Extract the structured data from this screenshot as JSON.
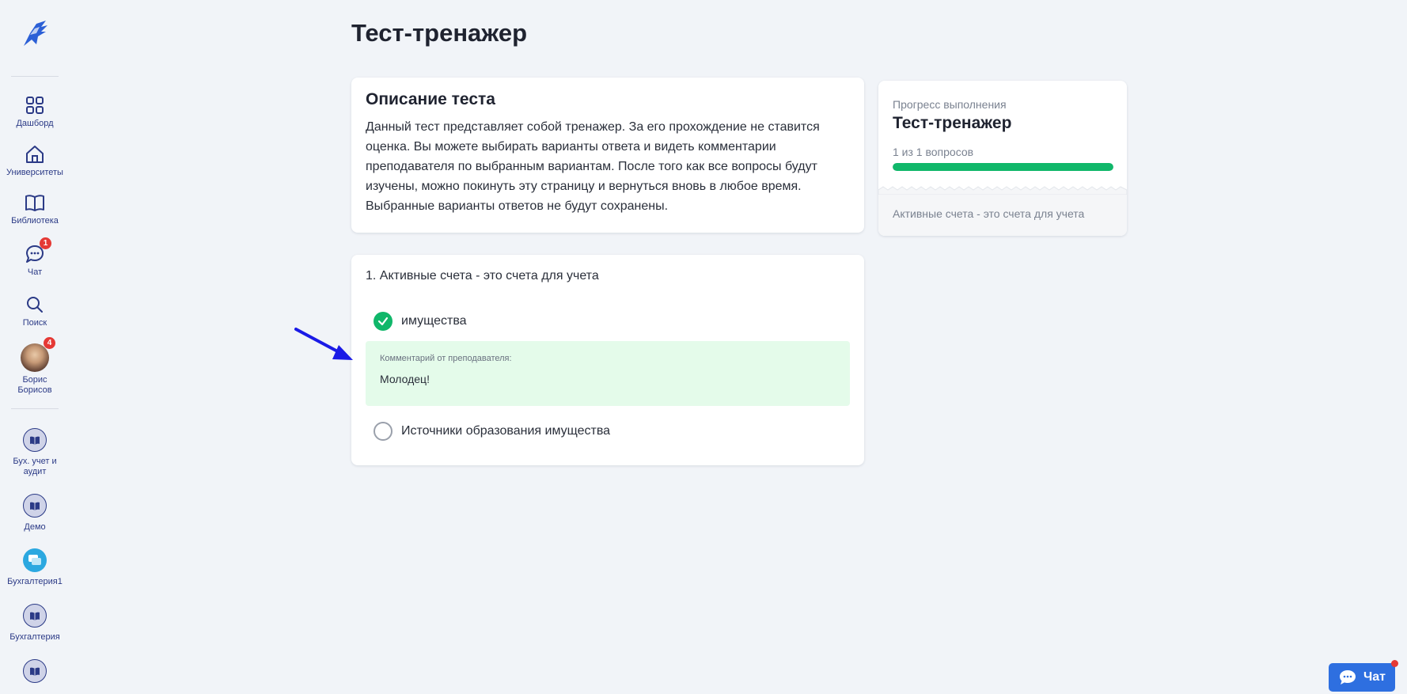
{
  "page": {
    "title": "Тест-тренажер"
  },
  "sidebar": {
    "nav": [
      {
        "label": "Дашборд",
        "icon": "dashboard-grid-icon"
      },
      {
        "label": "Университеты",
        "icon": "university-home-icon"
      },
      {
        "label": "Библиотека",
        "icon": "book-icon"
      },
      {
        "label": "Чат",
        "icon": "chat-icon",
        "badge": "1"
      },
      {
        "label": "Поиск",
        "icon": "search-icon"
      },
      {
        "label": "Борис Борисов",
        "icon": "avatar",
        "badge": "4"
      }
    ],
    "courses": [
      {
        "label": "Бух. учет и аудит",
        "icon": "course-book-icon"
      },
      {
        "label": "Демо",
        "icon": "course-book-icon"
      },
      {
        "label": "Бухгалтерия1",
        "icon": "course-chat-icon"
      },
      {
        "label": "Бухгалтерия",
        "icon": "course-book-icon"
      },
      {
        "label": "",
        "icon": "course-book-icon"
      }
    ]
  },
  "description": {
    "title": "Описание теста",
    "text": "Данный тест представляет собой тренажер. За его прохождение не ставится оценка. Вы можете выбирать варианты ответа и видеть комментарии преподавателя по выбранным вариантам. После того как все вопросы будут изучены, можно покинуть эту страницу и вернуться вновь в любое время. Выбранные варианты ответов не будут сохранены."
  },
  "question": {
    "title": "1. Активные счета - это счета для учета",
    "options": [
      {
        "label": "имущества",
        "selected": true
      },
      {
        "label": "Источники образования имущества",
        "selected": false
      }
    ],
    "comment": {
      "label": "Комментарий от преподавателя:",
      "text": "Молодец!"
    }
  },
  "progress": {
    "label": "Прогресс выполнения",
    "title": "Тест-тренажер",
    "count": "1 из 1 вопросов",
    "fraction": 1.0,
    "items": [
      "Активные счета - это счета для учета"
    ]
  },
  "chat_button": {
    "label": "Чат"
  },
  "colors": {
    "accent": "#10b76a",
    "nav": "#2b3a86",
    "badge": "#e53935",
    "chat": "#2e6fe0"
  }
}
